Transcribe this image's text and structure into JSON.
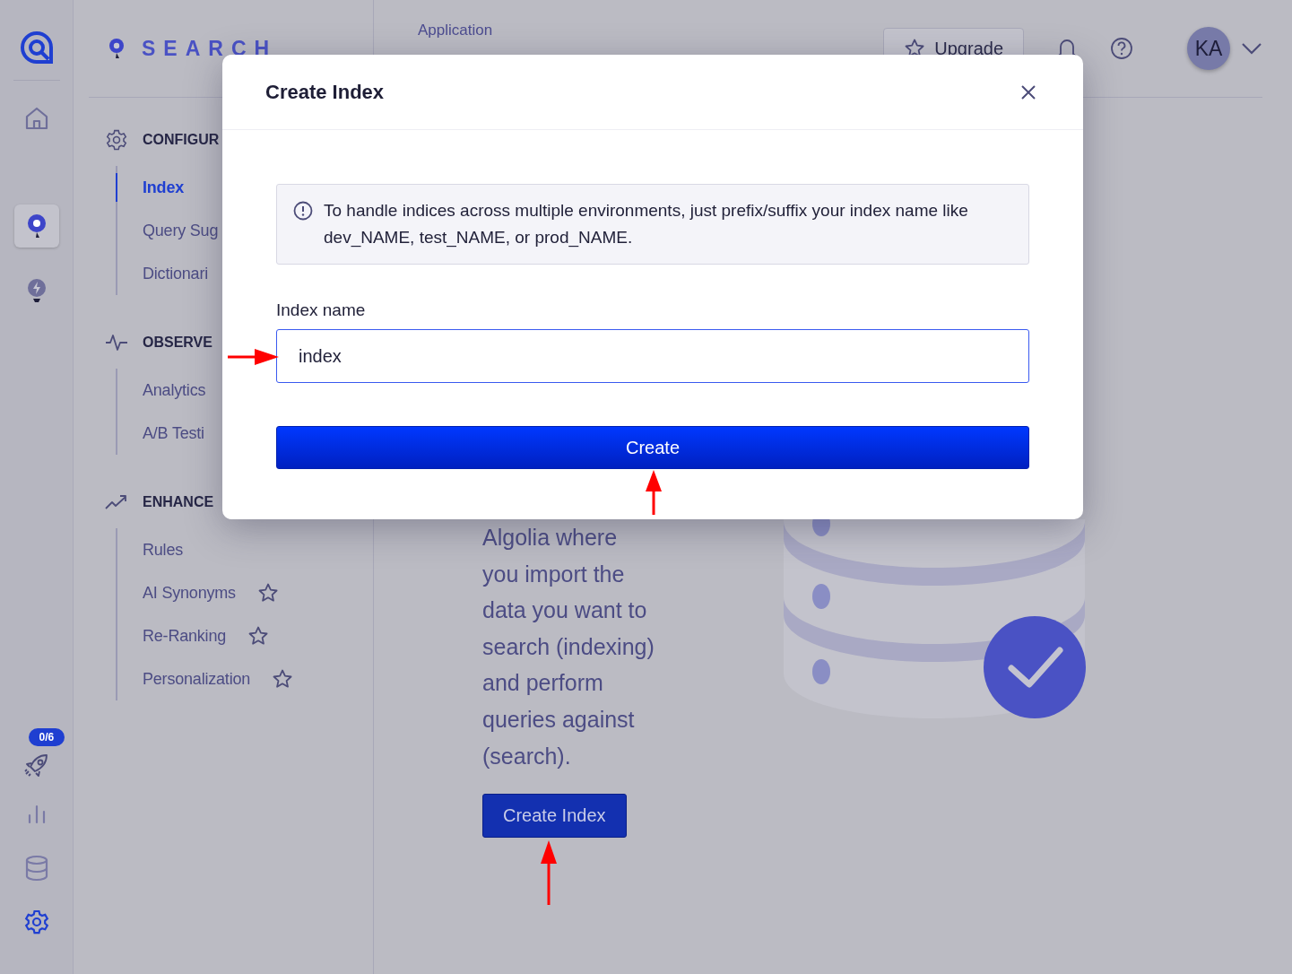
{
  "rail": {
    "top_items": [
      {
        "selected": false
      },
      {
        "selected": true
      },
      {
        "selected": false
      }
    ],
    "bottom_items": [
      {
        "selected": false,
        "badge": "0/6"
      },
      {
        "selected": false
      },
      {
        "selected": false
      },
      {
        "selected": true
      }
    ]
  },
  "sidebar": {
    "app_title": "SEARCH",
    "sections": [
      {
        "title": "CONFIGUR",
        "items": [
          {
            "label": "Index",
            "selected": true,
            "premium": false
          },
          {
            "label": "Query Sug",
            "selected": false,
            "premium": false
          },
          {
            "label": "Dictionari",
            "selected": false,
            "premium": false
          }
        ]
      },
      {
        "title": "OBSERVE",
        "items": [
          {
            "label": "Analytics",
            "selected": false,
            "premium": false
          },
          {
            "label": "A/B Testi",
            "selected": false,
            "premium": false
          }
        ]
      },
      {
        "title": "ENHANCE",
        "items": [
          {
            "label": "Rules",
            "selected": false,
            "premium": false
          },
          {
            "label": "AI Synonyms",
            "selected": false,
            "premium": true
          },
          {
            "label": "Re-Ranking",
            "selected": false,
            "premium": true
          },
          {
            "label": "Personalization",
            "selected": false,
            "premium": true
          }
        ]
      }
    ]
  },
  "header": {
    "application_label": "Application",
    "upgrade": "Upgrade",
    "avatar": "KA"
  },
  "main": {
    "description": "Algolia where you import the data you want to search (indexing) and perform queries against (search).",
    "button": "Create Index"
  },
  "dialog": {
    "title": "Create Index",
    "info": "To handle indices across multiple environments, just prefix/suffix your index name like dev_NAME, test_NAME, or prod_NAME.",
    "field_label": "Index name",
    "field_value": "index",
    "submit": "Create"
  }
}
